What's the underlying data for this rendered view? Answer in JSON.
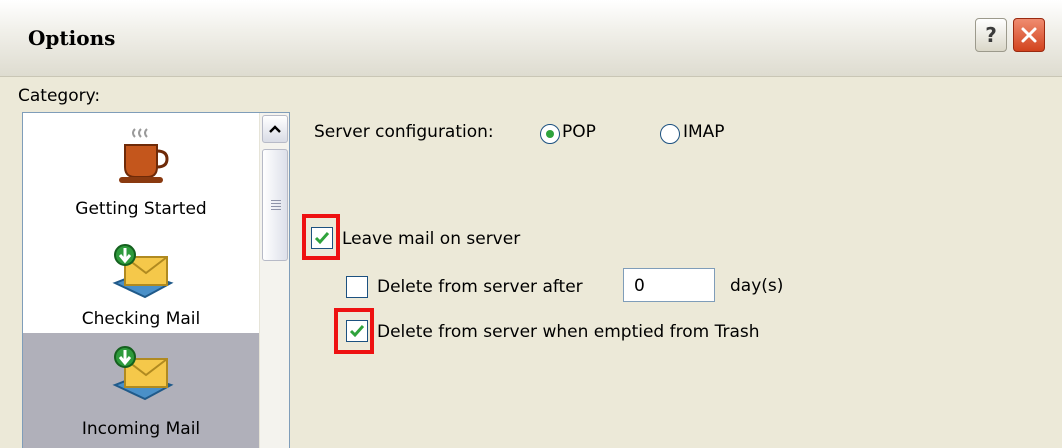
{
  "window": {
    "title": "Options",
    "help_label": "?",
    "close_color": "#D2431E"
  },
  "category": {
    "label": "Category:",
    "items": [
      {
        "label": "Getting Started",
        "icon": "coffee-cup-icon"
      },
      {
        "label": "Checking Mail",
        "icon": "mail-download-icon"
      },
      {
        "label": "Incoming Mail",
        "icon": "mail-download-icon",
        "selected": true
      }
    ]
  },
  "server_config": {
    "label": "Server configuration:",
    "options": [
      {
        "label": "POP",
        "selected": true
      },
      {
        "label": "IMAP",
        "selected": false
      }
    ]
  },
  "leave_mail": {
    "label": "Leave mail on server",
    "checked": true
  },
  "delete_after": {
    "label": "Delete from server after",
    "value": "0",
    "unit": "day(s)",
    "checked": false
  },
  "delete_trash": {
    "label": "Delete from server when emptied from Trash",
    "checked": true
  },
  "colors": {
    "highlight": "#EE1111",
    "check": "#2FA33C",
    "selection": "#B0B0BA"
  }
}
